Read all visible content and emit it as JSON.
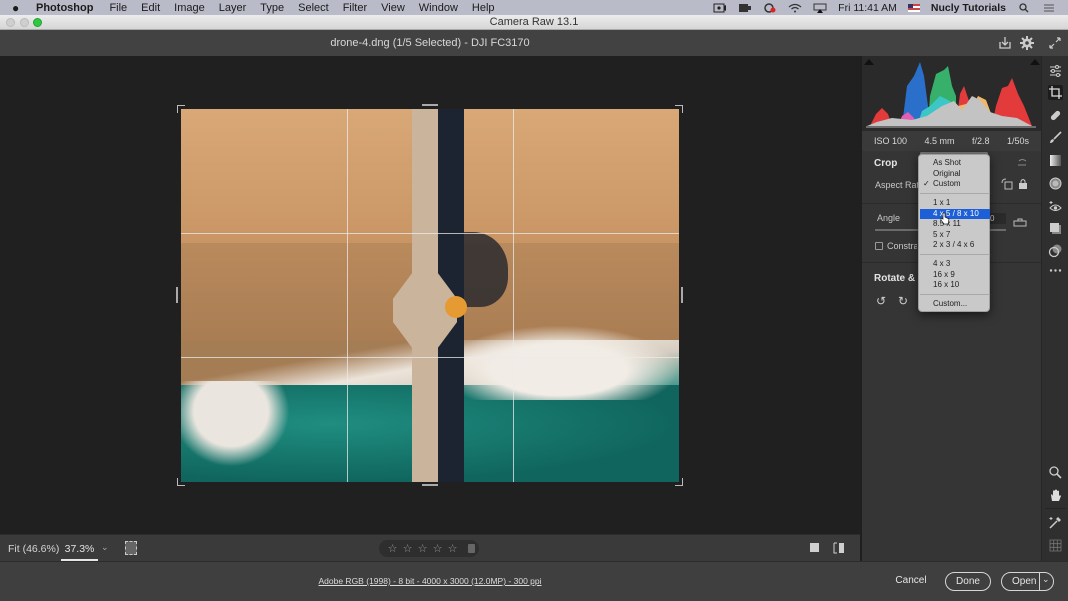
{
  "menubar": {
    "apple": "",
    "app": "Photoshop",
    "items": [
      "File",
      "Edit",
      "Image",
      "Layer",
      "Type",
      "Select",
      "Filter",
      "View",
      "Window",
      "Help"
    ],
    "clock": "Fri 11:41 AM",
    "user": "Nucly Tutorials",
    "status_icons": [
      "screen-record-icon",
      "battery-icon",
      "creative-cloud-icon",
      "wifi-icon",
      "airplay-icon",
      "flag-icon",
      "search-icon",
      "list-icon"
    ]
  },
  "window": {
    "title": "Camera Raw 13.1"
  },
  "header": {
    "document": "drone-4.dng (1/5 Selected)  -  DJI FC3170",
    "buttons": [
      "save-icon",
      "settings-icon",
      "fullscreen-icon"
    ]
  },
  "histogram": {
    "exif": {
      "iso": "ISO 100",
      "focal": "4.5 mm",
      "aperture": "f/2.8",
      "shutter": "1/50s"
    }
  },
  "crop_panel": {
    "title": "Crop",
    "aspect_ratio_label": "Aspect Ratio",
    "angle_label": "Angle",
    "angle_value": "0",
    "constrain_label": "Constrain to Image",
    "constrain_checked": false,
    "rotate_title": "Rotate & Flip"
  },
  "aspect_dropdown": {
    "checked": "Custom",
    "selected": "4 x 5 / 8 x 10",
    "groups": [
      [
        "As Shot",
        "Original",
        "Custom"
      ],
      [
        "1 x 1",
        "4 x 5 / 8 x 10",
        "8.5 x 11",
        "5 x 7",
        "2 x 3 / 4 x 6"
      ],
      [
        "4 x 3",
        "16 x 9",
        "16 x 10"
      ],
      [
        "Custom..."
      ]
    ]
  },
  "tool_rail": {
    "top": [
      "edit-sliders-icon",
      "crop-icon",
      "healing-icon",
      "brush-icon",
      "linear-gradient-icon",
      "radial-filter-icon",
      "red-eye-icon",
      "presets-icon",
      "snapshots-icon",
      "more-icon"
    ],
    "active": "crop-icon",
    "bottom": [
      "zoom-icon",
      "hand-icon",
      "color-sampler-icon",
      "grid-icon"
    ]
  },
  "viewbar": {
    "fit": "Fit (46.6%)",
    "zoom": "37.3%",
    "rating": {
      "stars": 0,
      "max": 5
    }
  },
  "footer": {
    "info": "Adobe RGB (1998) - 8 bit - 4000 x 3000 (12.0MP) - 300 ppi",
    "cancel": "Cancel",
    "done": "Done",
    "open": "Open"
  },
  "colors": {
    "selection": "#1d5fd6",
    "traffic_green": "#2fc840"
  }
}
